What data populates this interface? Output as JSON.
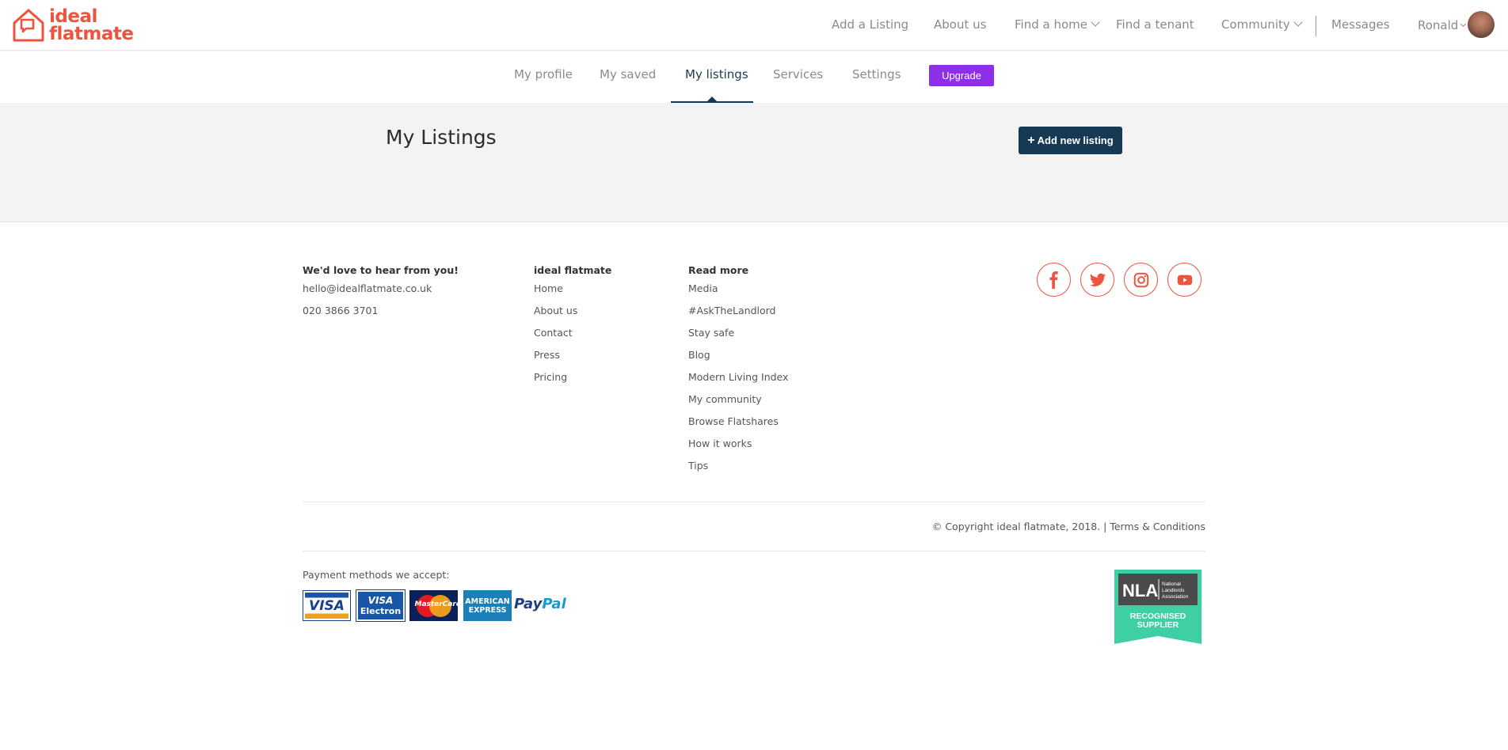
{
  "brand": {
    "line1": "ideal",
    "line2": "flatmate",
    "color": "#ee5340"
  },
  "topnav": {
    "add_listing": "Add a Listing",
    "about": "About us",
    "find_home": "Find a home",
    "find_tenant": "Find a tenant",
    "community": "Community",
    "messages": "Messages",
    "user": "Ronald"
  },
  "subnav": {
    "tabs": [
      {
        "label": "My profile"
      },
      {
        "label": "My saved"
      },
      {
        "label": "My listings"
      },
      {
        "label": "Services"
      },
      {
        "label": "Settings"
      }
    ],
    "active": "My listings",
    "upgrade_label": "Upgrade",
    "upgrade_color": "#8f2ee8"
  },
  "main": {
    "title": "My Listings",
    "add_button": "Add new listing",
    "add_icon": "plus-icon",
    "button_color": "#163a53"
  },
  "footer": {
    "contact": {
      "heading": "We'd love to hear from you!",
      "email": "hello@idealflatmate.co.uk",
      "phone": "020 3866 3701"
    },
    "ideal": {
      "heading": "ideal flatmate",
      "links": [
        "Home",
        "About us",
        "Contact",
        "Press",
        "Pricing"
      ]
    },
    "read_more": {
      "heading": "Read more",
      "links": [
        "Media",
        "#AskTheLandlord",
        "Stay safe",
        "Blog",
        "Modern Living Index",
        "My community",
        "Browse Flatshares",
        "How it works",
        "Tips"
      ]
    },
    "social": [
      "facebook-icon",
      "twitter-icon",
      "instagram-icon",
      "youtube-icon"
    ],
    "copyright": "© Copyright ideal flatmate, 2018. | Terms & Conditions",
    "payment_label": "Payment methods we accept:",
    "cards": {
      "visa": "VISA",
      "electron_top": "VISA",
      "electron_bottom": "Electron",
      "mastercard": "MasterCard",
      "amex_top": "AMERICAN",
      "amex_bottom": "EXPRESS",
      "paypal_a": "Pay",
      "paypal_b": "Pal"
    },
    "nla": {
      "abbr": "NLA",
      "name_1": "National",
      "name_2": "Landlords",
      "name_3": "Association",
      "line1": "RECOGNISED",
      "line2": "SUPPLIER"
    }
  }
}
